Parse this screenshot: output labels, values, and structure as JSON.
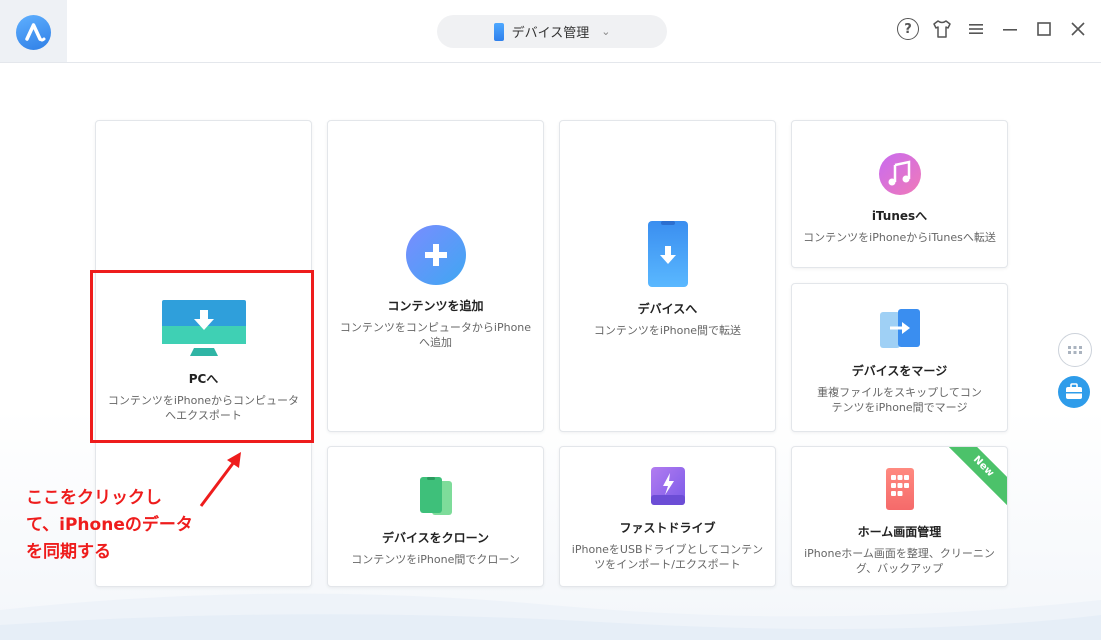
{
  "titlebar": {
    "device_label": "デバイス管理"
  },
  "cards": {
    "to_pc": {
      "title": "PCへ",
      "desc": "コンテンツをiPhoneからコンピュータへエクスポート"
    },
    "add_content": {
      "title": "コンテンツを追加",
      "desc": "コンテンツをコンピュータからiPhoneへ追加"
    },
    "to_device": {
      "title": "デバイスへ",
      "desc": "コンテンツをiPhone間で転送"
    },
    "to_itunes": {
      "title": "iTunesへ",
      "desc": "コンテンツをiPhoneからiTunesへ転送"
    },
    "merge_device": {
      "title": "デバイスをマージ",
      "desc": "重複ファイルをスキップしてコンテンツをiPhone間でマージ"
    },
    "clone_device": {
      "title": "デバイスをクローン",
      "desc": "コンテンツをiPhone間でクローン"
    },
    "fast_drive": {
      "title": "ファストドライブ",
      "desc": "iPhoneをUSBドライブとしてコンテンツをインポート/エクスポート"
    },
    "home_screen": {
      "title": "ホーム画面管理",
      "desc": "iPhoneホーム画面を整理、クリーニング、バックアップ",
      "badge": "New"
    }
  },
  "annotation": {
    "line1": "ここをクリックし",
    "line2": "て、iPhoneのデータ",
    "line3": "を同期する"
  },
  "colors": {
    "accent_blue": "#2e9cea",
    "highlight_red": "#ee1c1c",
    "new_badge_green": "#4cc26a"
  }
}
